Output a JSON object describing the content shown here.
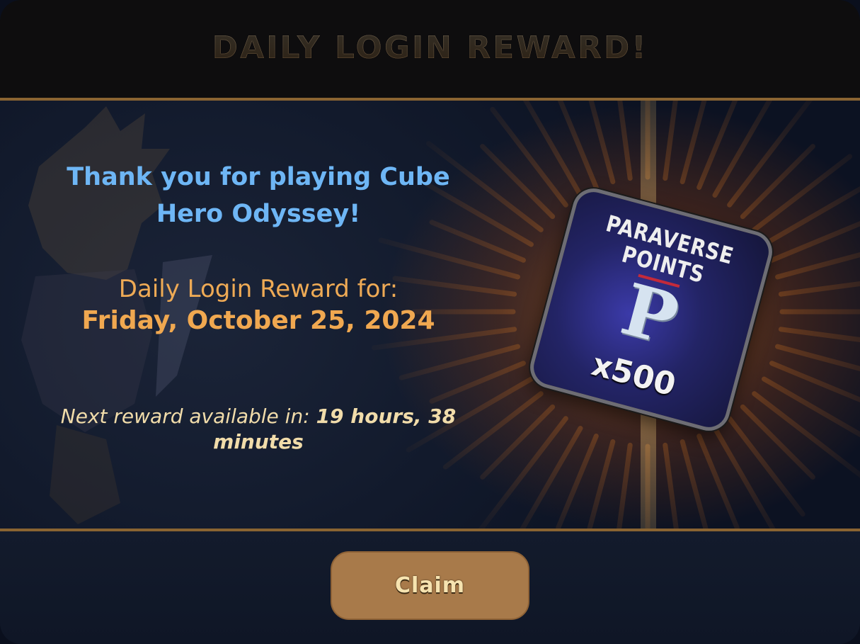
{
  "dialog": {
    "title": "DAILY LOGIN REWARD!"
  },
  "message": {
    "thanks_line1": "Thank you for playing Cube",
    "thanks_line2": "Hero Odyssey!",
    "reward_label": "Daily Login Reward for:",
    "reward_date": "Friday, October 25, 2024",
    "next_reward_label": "Next reward available in:",
    "next_reward_value_1": "19 hours, 38",
    "next_reward_value_2": "minutes"
  },
  "reward_item": {
    "title_line1": "PARAVERSE",
    "title_line2": "POINTS",
    "glyph": "P",
    "quantity": "x500",
    "icon": "paraverse-points-icon"
  },
  "actions": {
    "claim_label": "Claim"
  },
  "colors": {
    "title_gold": "#f0c58a",
    "thanks_blue": "#6eb6f5",
    "reward_orange": "#f0a850",
    "next_reward_cream": "#f1dcaa",
    "divider_bronze": "#8a6432",
    "button_tan": "#a87a4a"
  }
}
